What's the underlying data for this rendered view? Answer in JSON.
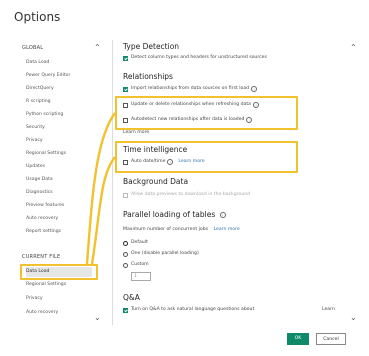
{
  "dialog": {
    "title": "Options"
  },
  "sidebar": {
    "global_header": "GLOBAL",
    "global_items": [
      "Data Load",
      "Power Query Editor",
      "DirectQuery",
      "R scripting",
      "Python scripting",
      "Security",
      "Privacy",
      "Regional Settings",
      "Updates",
      "Usage Data",
      "Diagnostics",
      "Preview features",
      "Auto recovery",
      "Report settings"
    ],
    "current_header": "CURRENT FILE",
    "current_items": [
      "Data Load",
      "Regional Settings",
      "Privacy",
      "Auto recovery"
    ],
    "selected": "Data Load"
  },
  "main": {
    "type_detection": {
      "title": "Type Detection",
      "option": "Detect column types and headers for unstructured sources"
    },
    "relationships": {
      "title": "Relationships",
      "opt1": "Import relationships from data sources on first load",
      "opt2": "Update or delete relationships when refreshing data",
      "opt3": "Autodetect new relationships after data is loaded",
      "learn_more": "Learn more"
    },
    "time_intelligence": {
      "title": "Time intelligence",
      "option": "Auto date/time",
      "learn_more": "Learn more"
    },
    "background_data": {
      "title": "Background Data",
      "option": "Allow data previews to download in the background"
    },
    "parallel": {
      "title": "Parallel loading of tables",
      "subtitle": "Maximum number of concurrent jobs",
      "learn_more": "Learn more",
      "radios": [
        "Default",
        "One (disable parallel loading)",
        "Custom"
      ],
      "custom_value": "1"
    },
    "qa": {
      "title": "Q&A",
      "option": "Turn on Q&A to ask natural language questions about",
      "learn_more": "Learn"
    }
  },
  "footer": {
    "ok": "OK",
    "cancel": "Cancel"
  },
  "colors": {
    "accent": "#0e8a6b",
    "highlight": "#f2c12e",
    "link": "#2f6fb3"
  }
}
